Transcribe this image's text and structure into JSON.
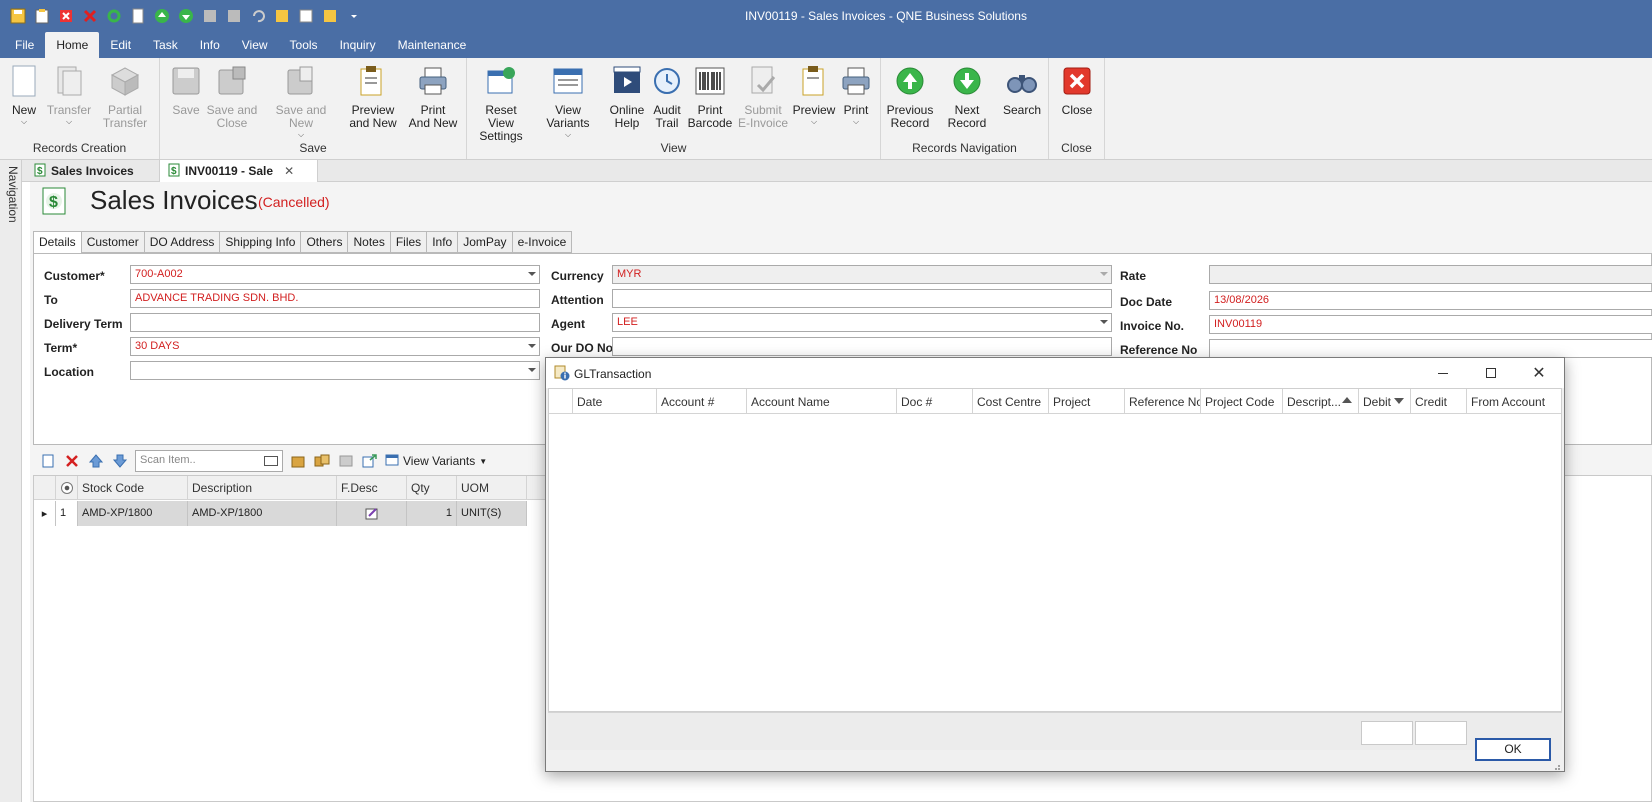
{
  "window": {
    "title": "INV00119 - Sales Invoices - QNE Business Solutions"
  },
  "menu": {
    "items": [
      "File",
      "Home",
      "Edit",
      "Task",
      "Info",
      "View",
      "Tools",
      "Inquiry",
      "Maintenance"
    ],
    "active": "Home"
  },
  "ribbon": {
    "groups": {
      "records_creation": "Records Creation",
      "save": "Save",
      "view": "View",
      "records_navigation": "Records Navigation",
      "close": "Close"
    },
    "buttons": {
      "new": "New",
      "transfer": "Transfer",
      "partial_transfer_1": "Partial",
      "partial_transfer_2": "Transfer",
      "save": "Save",
      "save_close_1": "Save and",
      "save_close_2": "Close",
      "save_new": "Save and New",
      "preview_new_1": "Preview",
      "preview_new_2": "and New",
      "print_new_1": "Print",
      "print_new_2": "And New",
      "reset_view_1": "Reset View",
      "reset_view_2": "Settings",
      "view_variants": "View Variants",
      "online_help_1": "Online",
      "online_help_2": "Help",
      "audit_trail_1": "Audit",
      "audit_trail_2": "Trail",
      "print_barcode_1": "Print",
      "print_barcode_2": "Barcode",
      "submit_einvoice_1": "Submit",
      "submit_einvoice_2": "E-Invoice",
      "preview": "Preview",
      "print": "Print",
      "previous_record_1": "Previous",
      "previous_record_2": "Record",
      "next_record": "Next Record",
      "search": "Search",
      "close": "Close"
    }
  },
  "navigation": {
    "label": "Navigation"
  },
  "doc_tabs": [
    {
      "label": "Sales Invoices"
    },
    {
      "label": "INV00119 - Sale"
    }
  ],
  "page": {
    "title": "Sales Invoices",
    "status": "(Cancelled)"
  },
  "form_tabs": [
    "Details",
    "Customer",
    "DO Address",
    "Shipping Info",
    "Others",
    "Notes",
    "Files",
    "Info",
    "JomPay",
    "e-Invoice"
  ],
  "form": {
    "customer_label": "Customer*",
    "customer": "700-A002",
    "to_label": "To",
    "to": "ADVANCE TRADING SDN. BHD.",
    "delivery_term_label": "Delivery Term",
    "delivery_term": "",
    "term_label": "Term*",
    "term": "30 DAYS",
    "location_label": "Location",
    "location": "",
    "currency_label": "Currency",
    "currency": "MYR",
    "attention_label": "Attention",
    "attention": "",
    "agent_label": "Agent",
    "agent": "LEE",
    "our_do_no_label": "Our DO No",
    "our_do_no": "",
    "rate_label": "Rate",
    "rate": "",
    "doc_date_label": "Doc Date",
    "doc_date": "13/08/2026",
    "invoice_no_label": "Invoice No.",
    "invoice_no": "INV00119",
    "reference_no_label": "Reference No",
    "reference_no": ""
  },
  "grid_toolbar": {
    "scan_placeholder": "Scan Item..",
    "view_variants": "View Variants"
  },
  "grid": {
    "columns": [
      "Stock Code",
      "Description",
      "F.Desc",
      "Qty",
      "UOM"
    ],
    "rows": [
      {
        "no": "1",
        "stock_code": "AMD-XP/1800",
        "description": "AMD-XP/1800",
        "qty": "1",
        "uom": "UNIT(S)"
      }
    ]
  },
  "dialog": {
    "title": "GLTransaction",
    "columns": [
      "Date",
      "Account #",
      "Account Name",
      "Doc #",
      "Cost Centre",
      "Project",
      "Reference No",
      "Project Code",
      "Descript...",
      "Debit",
      "Credit",
      "From Account"
    ],
    "ok_label": "OK"
  }
}
